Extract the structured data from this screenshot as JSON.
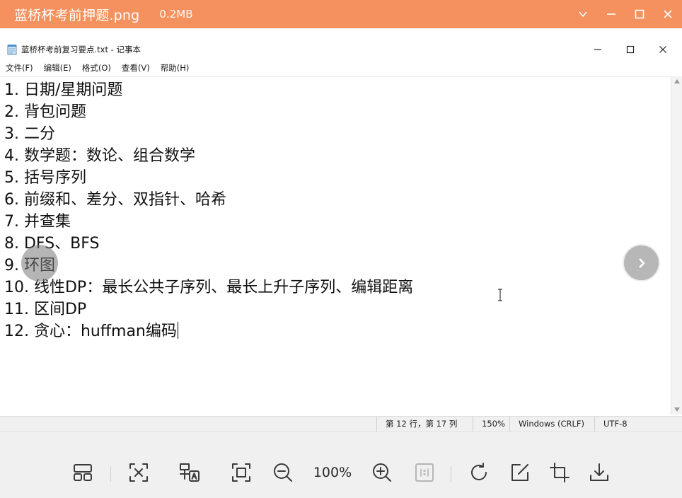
{
  "viewer": {
    "filename": "蓝桥杯考前押题.png",
    "filesize": "0.2MB",
    "accent_color": "#f4915f",
    "zoom_level": "100%"
  },
  "notepad": {
    "window_title": "蓝桥杯考前复习要点.txt - 记事本",
    "menu": [
      "文件(F)",
      "编辑(E)",
      "格式(O)",
      "查看(V)",
      "帮助(H)"
    ],
    "lines": [
      "1. 日期/星期问题",
      "2. 背包问题",
      "3. 二分",
      "4. 数学题：数论、组合数学",
      "5. 括号序列",
      "6. 前缀和、差分、双指针、哈希",
      "7. 并查集",
      "8. DFS、BFS",
      "9. 环图",
      "10. 线性DP：最长公共子序列、最长上升子序列、编辑距离",
      "11. 区间DP",
      "12. 贪心：huffman编码"
    ],
    "status": {
      "position": "第 12 行，第 17 列",
      "zoom": "150%",
      "line_ending": "Windows (CRLF)",
      "encoding": "UTF-8"
    }
  },
  "toolbar": {
    "buttons": [
      "gallery-icon",
      "fit-screen-icon",
      "ocr-icon",
      "actual-size-frame-icon",
      "zoom-out-icon",
      "zoom-in-icon",
      "one-to-one-icon",
      "rotate-icon",
      "edit-icon",
      "crop-icon",
      "download-icon"
    ]
  }
}
